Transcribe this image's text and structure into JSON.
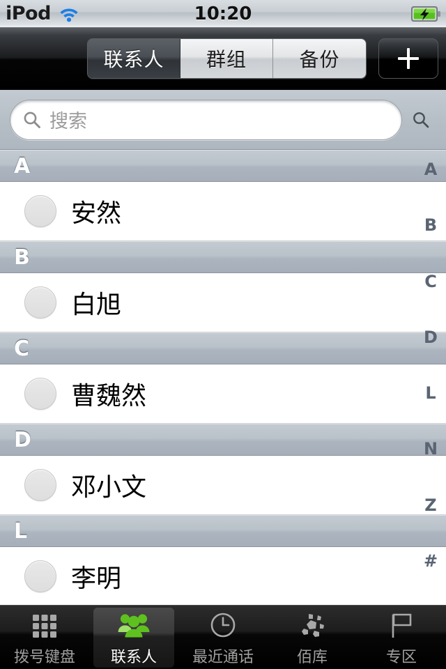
{
  "status_bar": {
    "carrier": "iPod",
    "time": "10:20",
    "wifi_icon": "wifi-icon",
    "battery_icon": "battery-charging-icon",
    "accent_wifi": "#1a7fe8",
    "accent_battery": "#57c020"
  },
  "navbar": {
    "segments": [
      {
        "label": "联系人",
        "selected": true
      },
      {
        "label": "群组",
        "selected": false
      },
      {
        "label": "备份",
        "selected": false
      }
    ],
    "add_button_label": "+"
  },
  "search": {
    "placeholder": "搜索",
    "value": "",
    "icon": "search-icon",
    "side_icon": "search-icon"
  },
  "list": {
    "sections": [
      {
        "letter": "A",
        "contacts": [
          {
            "name": "安然",
            "avatar": "default-avatar"
          }
        ]
      },
      {
        "letter": "B",
        "contacts": [
          {
            "name": "白旭",
            "avatar": "default-avatar"
          }
        ]
      },
      {
        "letter": "C",
        "contacts": [
          {
            "name": "曹魏然",
            "avatar": "default-avatar"
          }
        ]
      },
      {
        "letter": "D",
        "contacts": [
          {
            "name": "邓小文",
            "avatar": "default-avatar"
          }
        ]
      },
      {
        "letter": "L",
        "contacts": [
          {
            "name": "李明",
            "avatar": "default-avatar"
          }
        ]
      }
    ]
  },
  "index_bar": {
    "letters": [
      "A",
      "B",
      "C",
      "D",
      "L",
      "N",
      "Z",
      "#"
    ]
  },
  "tabbar": {
    "tabs": [
      {
        "label": "拨号键盘",
        "icon": "keypad-icon",
        "selected": false
      },
      {
        "label": "联系人",
        "icon": "contacts-people-icon",
        "selected": true
      },
      {
        "label": "最近通话",
        "icon": "clock-icon",
        "selected": false
      },
      {
        "label": "佰库",
        "icon": "polygon-cluster-icon",
        "selected": false
      },
      {
        "label": "专区",
        "icon": "flag-icon",
        "selected": false
      }
    ]
  }
}
